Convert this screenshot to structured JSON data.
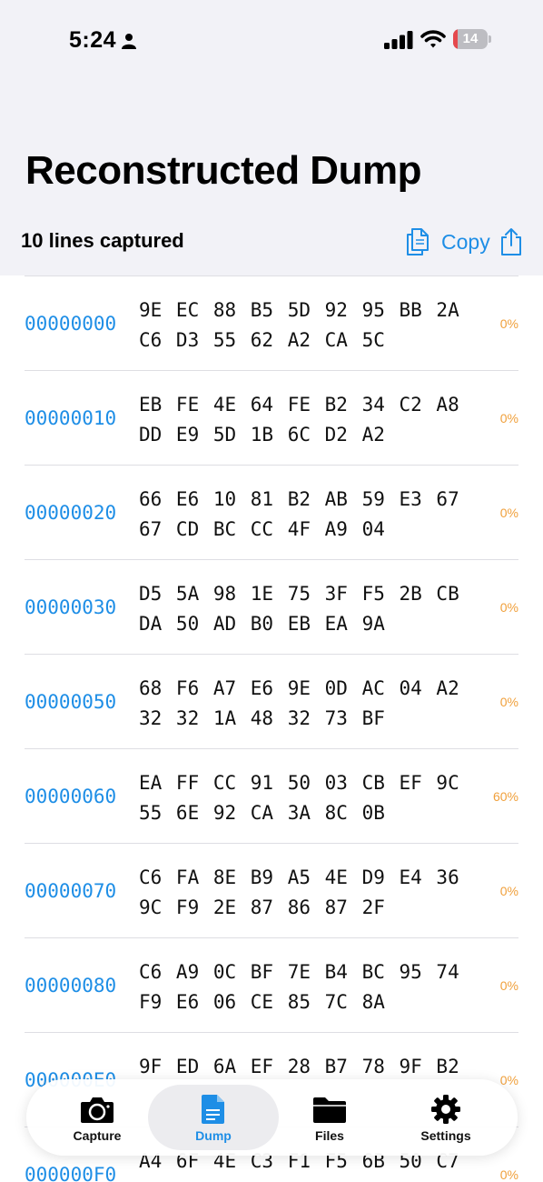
{
  "status": {
    "time": "5:24",
    "battery": "14",
    "battery_level": 0.14
  },
  "header": {
    "title": "Reconstructed Dump",
    "lines_captured": "10 lines captured",
    "copy_label": "Copy"
  },
  "rows": [
    {
      "offset": "00000000",
      "line1": "9E EC 88 B5 5D 92 95 BB 2A",
      "line2": "C6 D3 55 62 A2 CA 5C",
      "pct": "0%"
    },
    {
      "offset": "00000010",
      "line1": "EB FE 4E 64 FE B2 34 C2 A8",
      "line2": "DD E9 5D 1B 6C D2 A2",
      "pct": "0%"
    },
    {
      "offset": "00000020",
      "line1": "66 E6 10 81 B2 AB 59 E3 67",
      "line2": "67 CD BC CC 4F A9 04",
      "pct": "0%"
    },
    {
      "offset": "00000030",
      "line1": "D5 5A 98 1E 75 3F F5 2B CB",
      "line2": "DA 50 AD B0 EB EA 9A",
      "pct": "0%"
    },
    {
      "offset": "00000050",
      "line1": "68 F6 A7 E6 9E 0D AC 04 A2",
      "line2": "32 32 1A 48 32 73 BF",
      "pct": "0%"
    },
    {
      "offset": "00000060",
      "line1": "EA FF CC 91 50 03 CB EF 9C",
      "line2": "55 6E 92 CA 3A 8C 0B",
      "pct": "60%"
    },
    {
      "offset": "00000070",
      "line1": "C6 FA 8E B9 A5 4E D9 E4 36",
      "line2": "9C F9 2E 87 86 87 2F",
      "pct": "0%"
    },
    {
      "offset": "00000080",
      "line1": "C6 A9 0C BF 7E B4 BC 95 74",
      "line2": "F9 E6 06 CE 85 7C 8A",
      "pct": "0%"
    },
    {
      "offset": "000000E0",
      "line1": "9F ED 6A EF 28 B7 78 9F B2",
      "line2": "",
      "pct": "0%"
    },
    {
      "offset": "000000F0",
      "line1": "A4 6F 4E C3 F1 F5 6B 50 C7",
      "line2": "",
      "pct": "0%"
    }
  ],
  "tabs": [
    {
      "label": "Capture",
      "icon": "camera-icon"
    },
    {
      "label": "Dump",
      "icon": "document-icon",
      "selected": true
    },
    {
      "label": "Files",
      "icon": "folder-icon"
    },
    {
      "label": "Settings",
      "icon": "gear-icon"
    }
  ],
  "colors": {
    "accent": "#1e8ee6",
    "percent": "#f0a03c",
    "header_bg": "#f2f2f7"
  }
}
